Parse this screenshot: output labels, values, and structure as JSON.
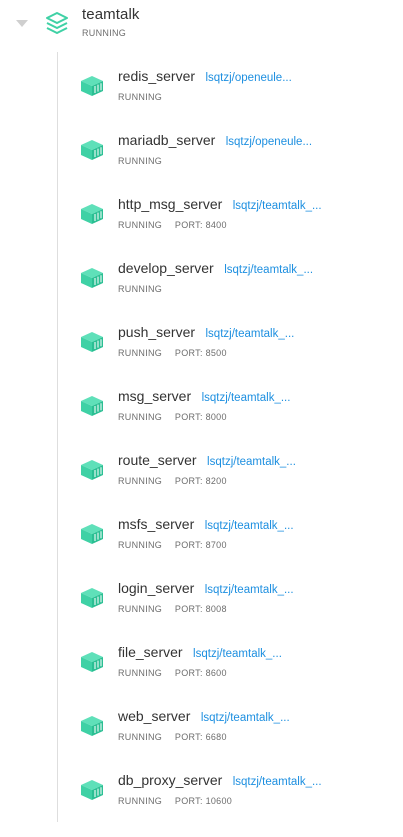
{
  "group": {
    "name": "teamtalk",
    "status": "RUNNING",
    "icon": "stack-icon"
  },
  "colors": {
    "icon_green": "#3fd1a5",
    "icon_green_dark": "#22b188",
    "link_blue": "#1d8fe0",
    "status_gray": "#6d6d6d",
    "tree_line": "#dedede"
  },
  "containers": [
    {
      "name": "redis_server",
      "image": "lsqtzj/openeule...",
      "status": "RUNNING",
      "port": ""
    },
    {
      "name": "mariadb_server",
      "image": "lsqtzj/openeule...",
      "status": "RUNNING",
      "port": ""
    },
    {
      "name": "http_msg_server",
      "image": "lsqtzj/teamtalk_...",
      "status": "RUNNING",
      "port": "PORT: 8400"
    },
    {
      "name": "develop_server",
      "image": "lsqtzj/teamtalk_...",
      "status": "RUNNING",
      "port": ""
    },
    {
      "name": "push_server",
      "image": "lsqtzj/teamtalk_...",
      "status": "RUNNING",
      "port": "PORT: 8500"
    },
    {
      "name": "msg_server",
      "image": "lsqtzj/teamtalk_...",
      "status": "RUNNING",
      "port": "PORT: 8000"
    },
    {
      "name": "route_server",
      "image": "lsqtzj/teamtalk_...",
      "status": "RUNNING",
      "port": "PORT: 8200"
    },
    {
      "name": "msfs_server",
      "image": "lsqtzj/teamtalk_...",
      "status": "RUNNING",
      "port": "PORT: 8700"
    },
    {
      "name": "login_server",
      "image": "lsqtzj/teamtalk_...",
      "status": "RUNNING",
      "port": "PORT: 8008"
    },
    {
      "name": "file_server",
      "image": "lsqtzj/teamtalk_...",
      "status": "RUNNING",
      "port": "PORT: 8600"
    },
    {
      "name": "web_server",
      "image": "lsqtzj/teamtalk_...",
      "status": "RUNNING",
      "port": "PORT: 6680"
    },
    {
      "name": "db_proxy_server",
      "image": "lsqtzj/teamtalk_...",
      "status": "RUNNING",
      "port": "PORT: 10600"
    }
  ]
}
